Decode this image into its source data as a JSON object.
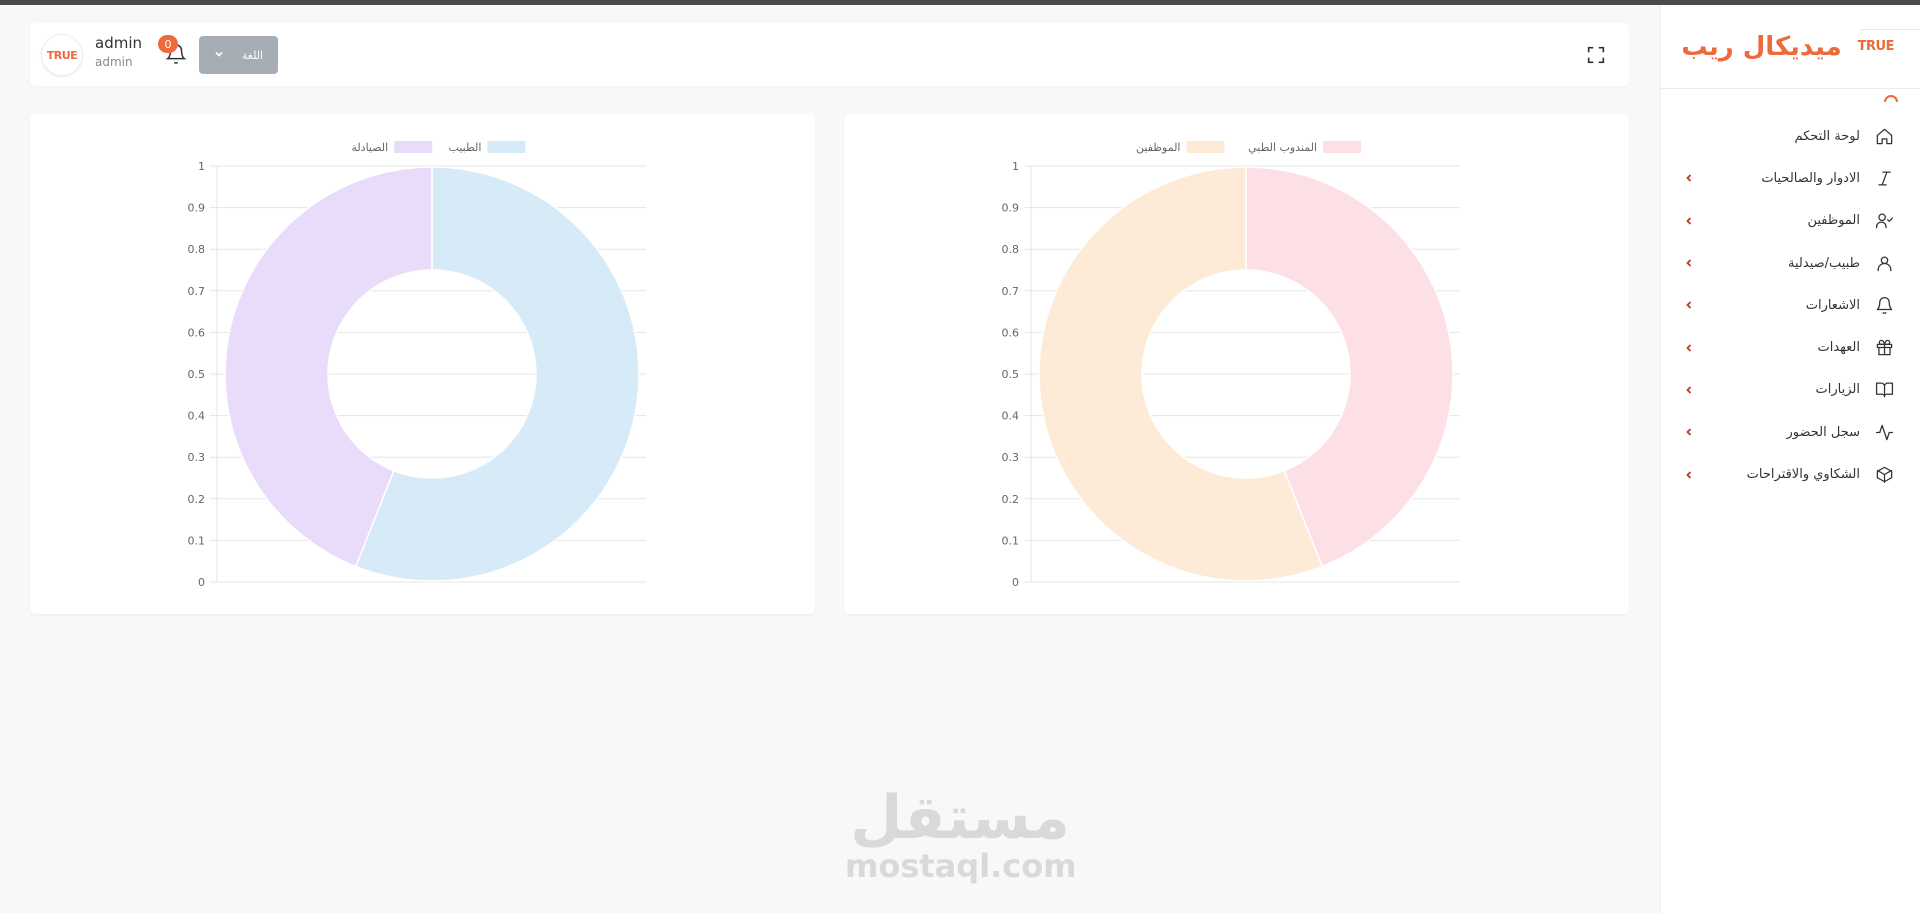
{
  "app": {
    "brand_title": "ميديكال ريب",
    "brand_logo": "TRUE"
  },
  "header": {
    "user_name": "admin",
    "user_role": "admin",
    "avatar_logo": "TRUE",
    "notification_count": "0",
    "language_label": "اللغة"
  },
  "sidebar": {
    "items": [
      {
        "label": "لوحة التحكم",
        "icon": "home-icon",
        "has_submenu": false
      },
      {
        "label": "الادوار والصالحيات",
        "icon": "italic-icon",
        "has_submenu": true
      },
      {
        "label": "الموظفين",
        "icon": "user-check-icon",
        "has_submenu": true
      },
      {
        "label": "طبيب/صيدلية",
        "icon": "user-icon",
        "has_submenu": true
      },
      {
        "label": "الاشعارات",
        "icon": "bell-icon",
        "has_submenu": true
      },
      {
        "label": "العهدات",
        "icon": "gift-icon",
        "has_submenu": true
      },
      {
        "label": "الزيارات",
        "icon": "book-open-icon",
        "has_submenu": true
      },
      {
        "label": "سجل الحضور",
        "icon": "activity-icon",
        "has_submenu": true
      },
      {
        "label": "الشكاوي والاقتراحات",
        "icon": "box-icon",
        "has_submenu": true
      }
    ]
  },
  "watermark": {
    "arabic": "مستقل",
    "latin": "mostaql.com"
  },
  "chart_data": [
    {
      "type": "pie",
      "variant": "doughnut",
      "legend_position": "top",
      "grid": true,
      "ylim": [
        0,
        1
      ],
      "y_ticks": [
        "0",
        "0.1",
        "0.2",
        "0.3",
        "0.4",
        "0.5",
        "0.6",
        "0.7",
        "0.8",
        "0.9",
        "1"
      ],
      "series": [
        {
          "name": "الطبيب",
          "value": 0.56,
          "color": "#d6eaf8"
        },
        {
          "name": "الصيادلة",
          "value": 0.44,
          "color": "#e8dcfa"
        }
      ]
    },
    {
      "type": "pie",
      "variant": "doughnut",
      "legend_position": "top",
      "grid": true,
      "ylim": [
        0,
        1
      ],
      "y_ticks": [
        "0",
        "0.1",
        "0.2",
        "0.3",
        "0.4",
        "0.5",
        "0.6",
        "0.7",
        "0.8",
        "0.9",
        "1"
      ],
      "series": [
        {
          "name": "المندوب الطبي",
          "value": 0.44,
          "color": "#fde0e6"
        },
        {
          "name": "الموظفين",
          "value": 0.56,
          "color": "#fdebd8"
        }
      ]
    }
  ]
}
